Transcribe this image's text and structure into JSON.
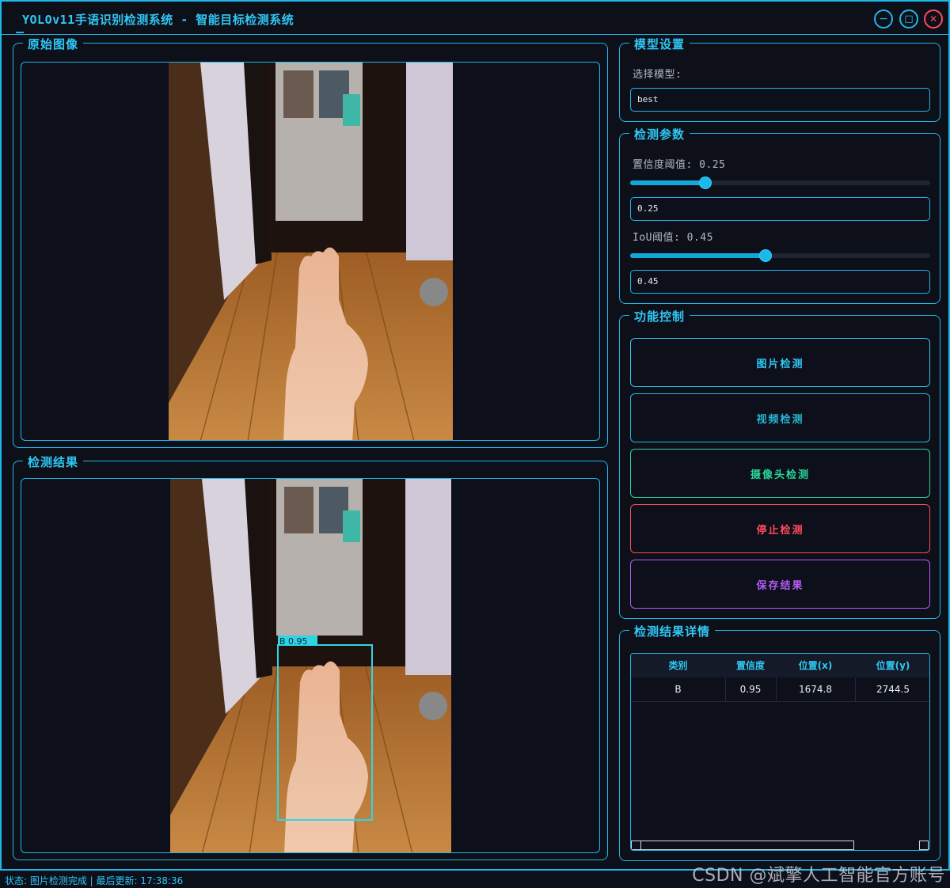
{
  "window": {
    "title": "YOLOv11手语识别检测系统 - 智能目标检测系统",
    "minimize_glyph": "−",
    "maximize_glyph": "◻",
    "close_glyph": "✕"
  },
  "left": {
    "original_title": "原始图像",
    "result_title": "检测结果",
    "detection_label": "B 0.95"
  },
  "model": {
    "group_title": "模型设置",
    "select_label": "选择模型:",
    "selected_value": "best"
  },
  "params": {
    "group_title": "检测参数",
    "confidence_label": "置信度阈值: 0.25",
    "confidence_value": "0.25",
    "confidence_level": 0.25,
    "iou_label": "IoU阈值: 0.45",
    "iou_value": "0.45",
    "iou_level": 0.45
  },
  "controls": {
    "group_title": "功能控制",
    "buttons": [
      {
        "label": "图片检测",
        "color": "#2fc7f5"
      },
      {
        "label": "视频检测",
        "color": "#25b8d6"
      },
      {
        "label": "摄像头检测",
        "color": "#2ad49a"
      },
      {
        "label": "停止检测",
        "color": "#ff4a5c"
      },
      {
        "label": "保存结果",
        "color": "#b45cf5"
      }
    ]
  },
  "details": {
    "group_title": "检测结果详情",
    "columns": [
      "类别",
      "置信度",
      "位置(x)",
      "位置(y)"
    ],
    "rows": [
      [
        "B",
        "0.95",
        "1674.8",
        "2744.5"
      ]
    ]
  },
  "status": {
    "text": "状态: 图片检测完成 | 最后更新: 17:38:36"
  },
  "watermark": "CSDN @斌擎人工智能官方账号"
}
